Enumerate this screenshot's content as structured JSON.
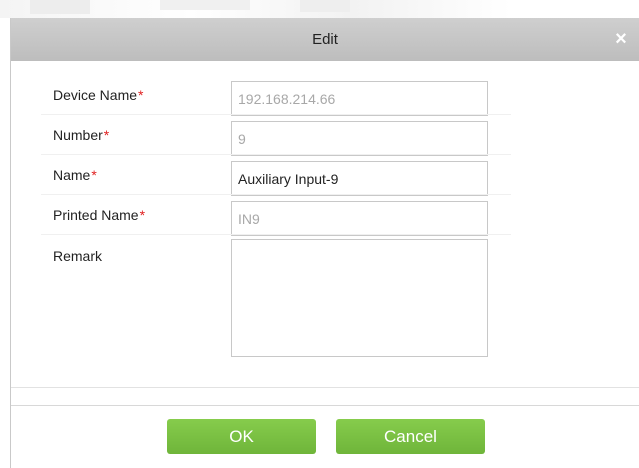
{
  "dialog": {
    "title": "Edit",
    "close_symbol": "×"
  },
  "form": {
    "device_name": {
      "label": "Device Name",
      "required_mark": "*",
      "value": "192.168.214.66",
      "disabled": true
    },
    "number": {
      "label": "Number",
      "required_mark": "*",
      "value": "9",
      "disabled": true
    },
    "name": {
      "label": "Name",
      "required_mark": "*",
      "value": "Auxiliary Input-9",
      "disabled": false
    },
    "printed_name": {
      "label": "Printed Name",
      "required_mark": "*",
      "value": "IN9",
      "disabled": true
    },
    "remark": {
      "label": "Remark",
      "value": ""
    }
  },
  "buttons": {
    "ok_label": "OK",
    "cancel_label": "Cancel"
  },
  "colors": {
    "title_bar": "#c4c4c4",
    "button_green": "#7ac143",
    "required_red": "#e02020",
    "disabled_text": "#a8a8a8"
  },
  "icons": {
    "close": "close-icon"
  }
}
